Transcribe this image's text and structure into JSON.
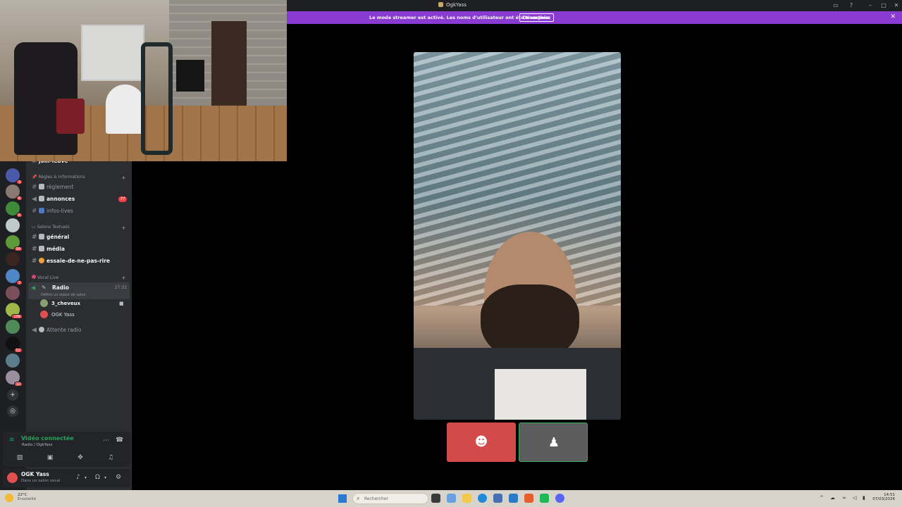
{
  "window": {
    "title": "OgkYass"
  },
  "banner": {
    "message": "Le mode streamer est activé. Les noms d'utilisateur ont été tronqués.",
    "button": "Désactiver"
  },
  "servers": {
    "badges": [
      "3",
      "6",
      "6",
      "99",
      "3",
      "186",
      "52",
      "10"
    ]
  },
  "channels": {
    "top_partial": "join-leave",
    "categories": {
      "rules": "Règles & Informations",
      "text": "Salons Textuels",
      "vocal": "Vocal Live"
    },
    "rules_items": [
      {
        "name": "règlement",
        "bold": false
      },
      {
        "name": "annonces",
        "bold": true,
        "badge": "77"
      },
      {
        "name": "infos-lives",
        "bold": false
      }
    ],
    "text_items": [
      {
        "name": "général",
        "bold": true
      },
      {
        "name": "média",
        "bold": true
      },
      {
        "name": "essaie-de-ne-pas-rire",
        "bold": true
      }
    ],
    "voice_active": {
      "name": "Radio",
      "status": "Définir un statut de salon",
      "timer": "27:31"
    },
    "members": [
      "3_cheveux",
      "OGK Yass"
    ],
    "voice_other": "Attente radio"
  },
  "voice_panel": {
    "state": "Vidéo connectée",
    "sub": "Radio / OgkYass"
  },
  "user": {
    "name": "OGK Yass",
    "status": "Dans un salon vocal"
  },
  "taskbar": {
    "weather_temp": "22°C",
    "weather_desc": "Ensoleillé",
    "search": "Rechercher",
    "time": "14:51",
    "date": "07/03/2026"
  },
  "colors": {
    "banner": "#8a3bd1",
    "online_green": "#23a55a",
    "badge_red": "#f23f43",
    "tile_red": "#d24a4a"
  }
}
